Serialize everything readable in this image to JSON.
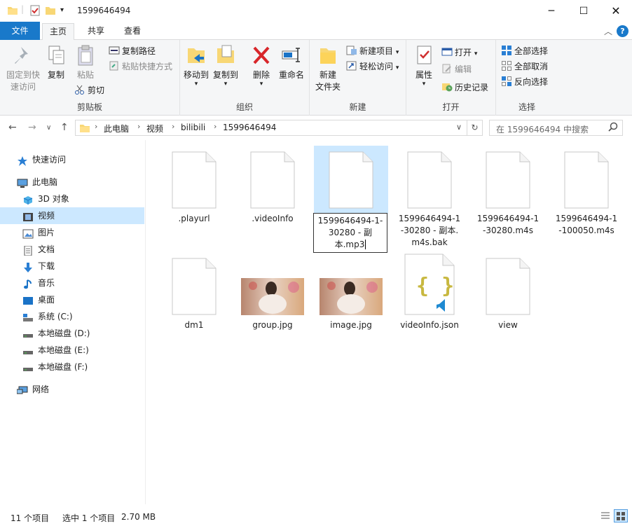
{
  "window": {
    "title": "1599646494"
  },
  "tabs": [
    "文件",
    "主页",
    "共享",
    "查看"
  ],
  "ribbon": {
    "clipboard": {
      "pin_line1": "固定到快",
      "pin_line2": "速访问",
      "copy": "复制",
      "paste": "粘贴",
      "copy_path": "复制路径",
      "paste_shortcut": "粘贴快捷方式",
      "cut": "剪切",
      "group": "剪贴板"
    },
    "organize": {
      "move_to": "移动到",
      "copy_to": "复制到",
      "delete": "删除",
      "rename": "重命名",
      "group": "组织"
    },
    "new": {
      "new_folder_line1": "新建",
      "new_folder_line2": "文件夹",
      "new_item": "新建项目",
      "easy_access": "轻松访问",
      "group": "新建"
    },
    "open": {
      "properties": "属性",
      "open": "打开",
      "edit": "编辑",
      "history": "历史记录",
      "group": "打开"
    },
    "select": {
      "select_all": "全部选择",
      "select_none": "全部取消",
      "invert": "反向选择",
      "group": "选择"
    }
  },
  "address": {
    "crumbs": [
      "此电脑",
      "视频",
      "bilibili",
      "1599646494"
    ],
    "search_placeholder": "在 1599646494 中搜索"
  },
  "sidebar": {
    "items": [
      {
        "label": "快速访问",
        "icon": "star-icon"
      },
      {
        "label": "此电脑",
        "icon": "computer-icon"
      },
      {
        "label": "3D 对象",
        "icon": "cube-icon"
      },
      {
        "label": "视频",
        "icon": "video-icon"
      },
      {
        "label": "图片",
        "icon": "pictures-icon"
      },
      {
        "label": "文档",
        "icon": "documents-icon"
      },
      {
        "label": "下载",
        "icon": "download-icon"
      },
      {
        "label": "音乐",
        "icon": "music-icon"
      },
      {
        "label": "桌面",
        "icon": "desktop-icon"
      },
      {
        "label": "系统 (C:)",
        "icon": "system-drive-icon"
      },
      {
        "label": "本地磁盘 (D:)",
        "icon": "drive-icon"
      },
      {
        "label": "本地磁盘 (E:)",
        "icon": "drive-icon"
      },
      {
        "label": "本地磁盘 (F:)",
        "icon": "drive-icon"
      },
      {
        "label": "网络",
        "icon": "network-icon"
      }
    ]
  },
  "files": [
    {
      "name": ".playurl",
      "type": "blank"
    },
    {
      "name": ".videoInfo",
      "type": "blank"
    },
    {
      "name": "1599646494-1-30280 - 副本.mp3",
      "type": "blank"
    },
    {
      "name": "1599646494-1-30280 - 副本.m4s.bak",
      "type": "blank"
    },
    {
      "name": "1599646494-1-30280.m4s",
      "type": "blank"
    },
    {
      "name": "1599646494-1-100050.m4s",
      "type": "blank"
    },
    {
      "name": "dm1",
      "type": "blank"
    },
    {
      "name": "group.jpg",
      "type": "image"
    },
    {
      "name": "image.jpg",
      "type": "image"
    },
    {
      "name": "videoInfo.json",
      "type": "json"
    },
    {
      "name": "view",
      "type": "blank"
    }
  ],
  "rename_lines": [
    "1599646494-1-",
    "30280 - 副",
    "本.mp3"
  ],
  "status": {
    "count": "11 个项目",
    "selected": "选中 1 个项目",
    "size": "2.70 MB"
  },
  "colors": {
    "accent": "#1979ca",
    "selection": "#cce8ff"
  }
}
